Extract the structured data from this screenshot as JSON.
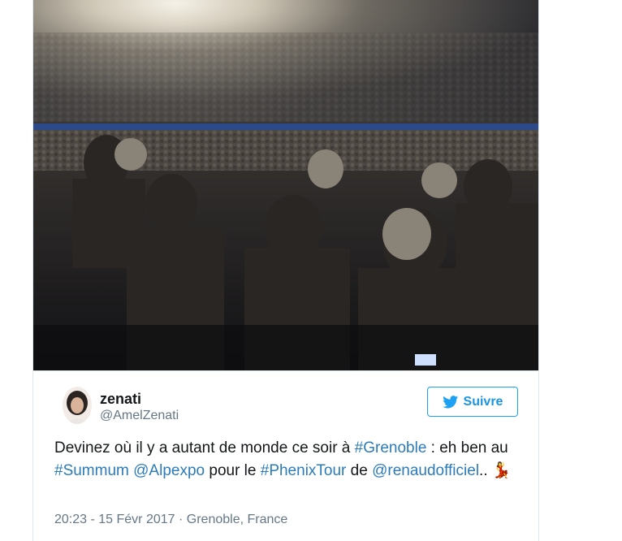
{
  "user": {
    "display_name": "zenati",
    "handle": "@AmelZenati"
  },
  "follow_button": {
    "label": "Suivre",
    "icon": "twitter-bird-icon"
  },
  "tweet": {
    "segments": [
      {
        "type": "text",
        "value": "Devinez où il y a autant de monde ce soir à "
      },
      {
        "type": "hashtag",
        "value": "#Grenoble"
      },
      {
        "type": "text",
        "value": " : eh ben au "
      },
      {
        "type": "hashtag",
        "value": "#Summum"
      },
      {
        "type": "text",
        "value": " "
      },
      {
        "type": "mention",
        "value": "@Alpexpo"
      },
      {
        "type": "text",
        "value": " pour le "
      },
      {
        "type": "hashtag",
        "value": "#PhenixTour"
      },
      {
        "type": "text",
        "value": " de "
      },
      {
        "type": "mention",
        "value": "@renaudofficiel"
      },
      {
        "type": "text",
        "value": ".. "
      },
      {
        "type": "emoji",
        "value": "💃"
      }
    ]
  },
  "meta": {
    "time": "20:23 - 15 Févr 2017",
    "separator": "·",
    "location": "Grenoble, France"
  },
  "photo": {
    "description_icon": "concert-crowd-photo"
  },
  "colors": {
    "link": "#2b7bb9",
    "follow_border": "#1da1f2",
    "muted": "#657786",
    "text": "#14171a"
  }
}
